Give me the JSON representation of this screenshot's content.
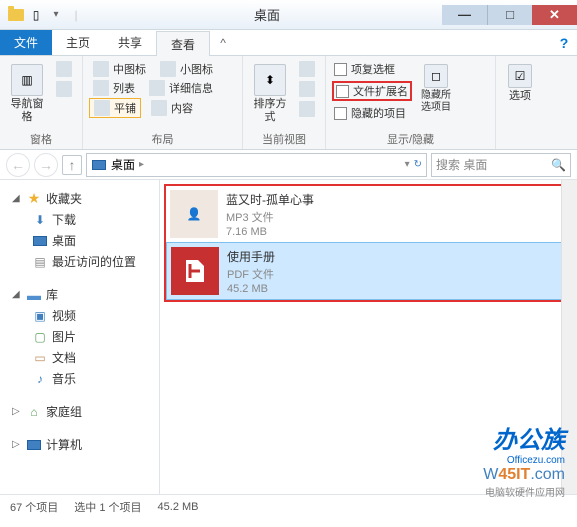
{
  "window": {
    "title": "桌面"
  },
  "tabs": {
    "file": "文件",
    "home": "主页",
    "share": "共享",
    "view": "查看"
  },
  "ribbon": {
    "pane": {
      "nav": "导航窗格",
      "label": "窗格"
    },
    "layout": {
      "medium_icons": "中图标",
      "small_icons": "小图标",
      "list": "列表",
      "details": "详细信息",
      "tiles": "平铺",
      "content": "内容",
      "label": "布局"
    },
    "current_view": {
      "sort": "排序方式",
      "label": "当前视图"
    },
    "show_hide": {
      "item_checkboxes": "项复选框",
      "file_extensions": "文件扩展名",
      "hidden_items": "隐藏的项目",
      "hide_selected": "隐藏所选项目",
      "label": "显示/隐藏"
    },
    "options": {
      "btn": "选项"
    }
  },
  "nav": {
    "location": "桌面",
    "search_placeholder": "搜索 桌面"
  },
  "sidebar": {
    "favorites": "收藏夹",
    "downloads": "下载",
    "desktop": "桌面",
    "recent": "最近访问的位置",
    "libraries": "库",
    "videos": "视频",
    "pictures": "图片",
    "documents": "文档",
    "music": "音乐",
    "homegroup": "家庭组",
    "computer": "计算机"
  },
  "files": [
    {
      "name": "蓝又时-孤单心事",
      "type": "MP3 文件",
      "size": "7.16 MB"
    },
    {
      "name": "使用手册",
      "type": "PDF 文件",
      "size": "45.2 MB"
    }
  ],
  "status": {
    "total": "67 个项目",
    "selected": "选中 1 个项目",
    "size": "45.2 MB"
  },
  "watermark": {
    "brand1": "办公族",
    "brand1_sub": "Officezu.com",
    "brand2_pre": "W",
    "brand2_highlight": "45IT",
    "brand2_post": ".com",
    "brand2_sub": "电脑软硬件应用网"
  }
}
